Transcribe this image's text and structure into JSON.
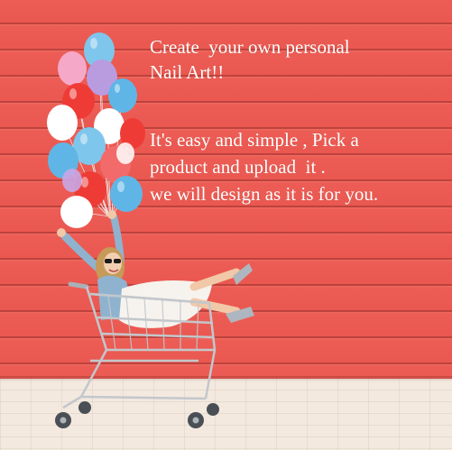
{
  "banner": {
    "headline": {
      "line1": "Create  your own personal",
      "line2": "Nail Art!!"
    },
    "body": {
      "line1": "It's easy and simple , Pick a",
      "line2": "product and upload  it .",
      "line3": "we will design as it is for you."
    }
  },
  "illustration": {
    "subject": "woman-in-shopping-cart-with-balloons-icon",
    "balloon_colors": [
      "#7fc6ec",
      "#f6a8c8",
      "#b99be0",
      "#ef3b36",
      "#ffffff",
      "#5fb6e6"
    ]
  },
  "colors": {
    "wall": "#ea5850",
    "floor": "#f3e9df",
    "text": "#ffffff"
  }
}
